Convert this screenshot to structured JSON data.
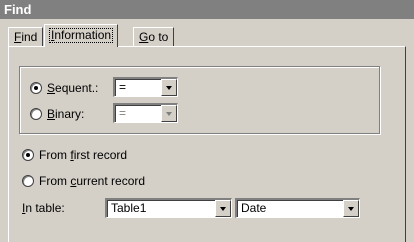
{
  "window": {
    "title": "Find"
  },
  "tabs": [
    {
      "pre": "",
      "key": "F",
      "post": "ind"
    },
    {
      "pre": "",
      "key": "I",
      "post": "nformation"
    },
    {
      "pre": "",
      "key": "G",
      "post": "o to"
    }
  ],
  "search_method": {
    "sequent": {
      "pre": "",
      "key": "S",
      "post": "equent.:",
      "checked": true,
      "combo_value": "="
    },
    "binary": {
      "pre": "",
      "key": "B",
      "post": "inary:",
      "checked": false,
      "combo_value": "="
    }
  },
  "start": {
    "first": {
      "pre": "From ",
      "key": "f",
      "post": "irst record",
      "checked": true
    },
    "current": {
      "pre": "From ",
      "key": "c",
      "post": "urrent record",
      "checked": false
    }
  },
  "in_table": {
    "pre": "",
    "key": "I",
    "post": "n table:",
    "table_value": "Table1",
    "field_value": "Date"
  }
}
